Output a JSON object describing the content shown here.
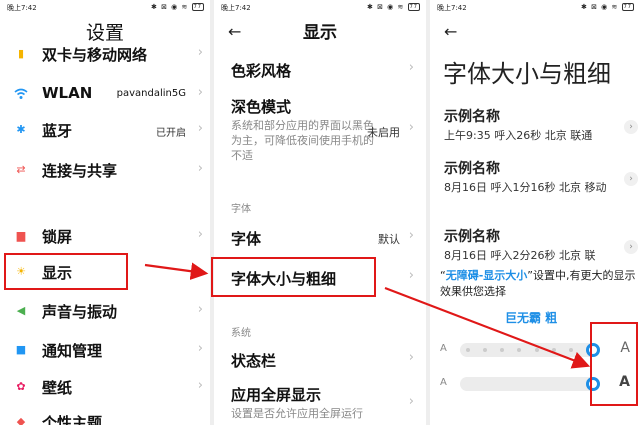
{
  "status": {
    "left_time": "晚上7:42",
    "mid_time": "晚上7:42",
    "right_time": "晚上7:42",
    "icons": "✱ ⊠ ◉ ≋",
    "battery": "77"
  },
  "settings": {
    "title": "设置",
    "items": [
      {
        "icon": "sim-card-icon",
        "glyph": "▮",
        "color": "#f5b400",
        "label": "双卡与移动网络",
        "value": ""
      },
      {
        "icon": "wifi-icon",
        "glyph": "◠",
        "color": "#2196f3",
        "label": "WLAN",
        "value": "pavandalin5G"
      },
      {
        "icon": "bluetooth-icon",
        "glyph": "✱",
        "color": "#2196f3",
        "label": "蓝牙",
        "value": "已开启"
      },
      {
        "icon": "connection-share-icon",
        "glyph": "⇄",
        "color": "#ef5350",
        "label": "连接与共享",
        "value": ""
      },
      {
        "icon": "lock-screen-icon",
        "glyph": "▆",
        "color": "#ef5350",
        "label": "锁屏",
        "value": ""
      },
      {
        "icon": "display-sun-icon",
        "glyph": "☀",
        "color": "#f5b400",
        "label": "显示",
        "value": ""
      },
      {
        "icon": "sound-icon",
        "glyph": "◀",
        "color": "#4caf50",
        "label": "声音与振动",
        "value": ""
      },
      {
        "icon": "notification-icon",
        "glyph": "■",
        "color": "#2196f3",
        "label": "通知管理",
        "value": ""
      },
      {
        "icon": "wallpaper-icon",
        "glyph": "✿",
        "color": "#e91e63",
        "label": "壁纸",
        "value": ""
      },
      {
        "icon": "theme-icon",
        "glyph": "◆",
        "color": "#ef5350",
        "label": "个性主题",
        "value": ""
      }
    ]
  },
  "display": {
    "back": "←",
    "title": "显示",
    "color_style": "色彩风格",
    "dark_mode": {
      "label": "深色模式",
      "desc": "系统和部分应用的界面以黑色为主，可降低夜间使用手机的不适",
      "value": "未启用"
    },
    "font_section": "字体",
    "font": {
      "label": "字体",
      "value": "默认"
    },
    "font_size": "字体大小与粗细",
    "system_section": "系统",
    "status_bar": "状态栏",
    "fullscreen": {
      "label": "应用全屏显示",
      "desc": "设置是否允许应用全屏运行"
    }
  },
  "font_size_page": {
    "back": "←",
    "title": "字体大小与粗细",
    "samples": [
      {
        "name": "示例名称",
        "meta": "上午9:35 呼入26秒 北京 联通"
      },
      {
        "name": "示例名称",
        "meta": "8月16日 呼入1分16秒 北京 移动"
      },
      {
        "name": "示例名称",
        "meta": "8月16日 呼入2分26秒 北京 联"
      }
    ],
    "hint_open_quote": "“",
    "hint_link": "无障碍-显示大小",
    "hint_rest": "”设置中,有更大的显示效果供您选择",
    "blue_note": "巨无霸 粗",
    "size_slider": {
      "small": "A",
      "big": "A",
      "level": 1.0,
      "ticks": 8
    },
    "weight_slider": {
      "small": "A",
      "big": "A",
      "level": 1.0
    }
  },
  "colors": {
    "accent": "#1e8fe6",
    "annotation": "#e01818"
  }
}
